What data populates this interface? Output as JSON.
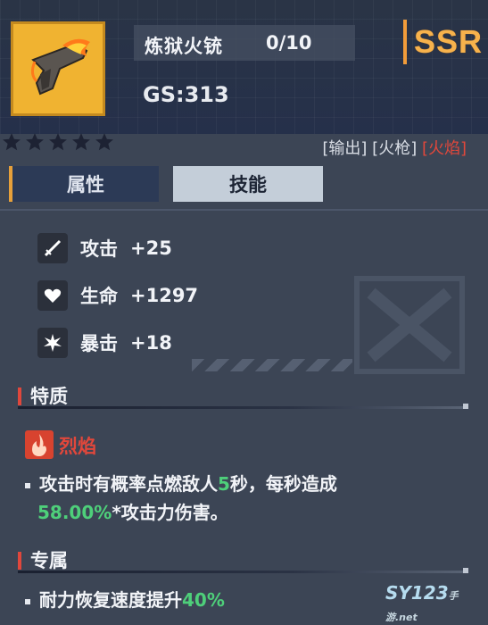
{
  "item": {
    "name": "炼狱火铳",
    "level": "0/10",
    "gs": "GS:313",
    "rarity": "SSR",
    "stars": 5
  },
  "tags": {
    "t1": "[输出]",
    "t2": "[火枪]",
    "t3": "[火焰]"
  },
  "tabs": {
    "attributes": "属性",
    "skills": "技能"
  },
  "stats": [
    {
      "label": "攻击",
      "value": "+25",
      "icon": "sword-icon"
    },
    {
      "label": "生命",
      "value": "+1297",
      "icon": "heart-icon"
    },
    {
      "label": "暴击",
      "value": "+18",
      "icon": "burst-icon"
    }
  ],
  "trait": {
    "header": "特质",
    "skill_name": "烈焰",
    "desc_part1": "攻击时有概率点燃敌人",
    "desc_highlight1": "5",
    "desc_part2": "秒，每秒造成",
    "desc_highlight2": "58.00%",
    "desc_part3": "*攻击力伤害。"
  },
  "exclusive": {
    "header": "专属",
    "desc_part1": "耐力恢复速度提升",
    "desc_highlight": "40%"
  },
  "watermark": {
    "brand": "SY123",
    "sub": "手游",
    "domain": ".net"
  },
  "colors": {
    "rarity": "#f7b24c",
    "fire_tag": "#e1473b",
    "highlight": "#4ecf7a"
  }
}
